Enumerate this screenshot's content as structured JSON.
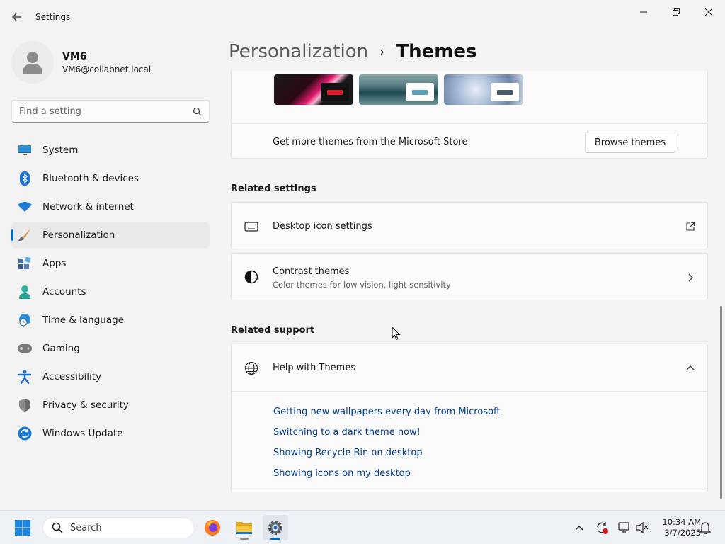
{
  "window": {
    "app_title": "Settings",
    "back_icon": "back-arrow-icon",
    "controls": [
      "minimize-icon",
      "restore-icon",
      "close-icon"
    ]
  },
  "profile": {
    "name": "VM6",
    "email": "VM6@collabnet.local"
  },
  "search": {
    "placeholder": "Find a setting",
    "value": ""
  },
  "sidebar": {
    "items": [
      {
        "label": "System",
        "icon": "monitor-icon"
      },
      {
        "label": "Bluetooth & devices",
        "icon": "bluetooth-icon"
      },
      {
        "label": "Network & internet",
        "icon": "wifi-icon"
      },
      {
        "label": "Personalization",
        "icon": "brush-icon",
        "active": true
      },
      {
        "label": "Apps",
        "icon": "apps-icon"
      },
      {
        "label": "Accounts",
        "icon": "person-icon"
      },
      {
        "label": "Time & language",
        "icon": "globe-clock-icon"
      },
      {
        "label": "Gaming",
        "icon": "gamepad-icon"
      },
      {
        "label": "Accessibility",
        "icon": "accessibility-icon"
      },
      {
        "label": "Privacy & security",
        "icon": "shield-icon"
      },
      {
        "label": "Windows Update",
        "icon": "update-icon"
      }
    ]
  },
  "breadcrumb": {
    "parent": "Personalization",
    "separator": "›",
    "current": "Themes"
  },
  "themes": {
    "more_text": "Get more themes from the Microsoft Store",
    "browse_label": "Browse themes"
  },
  "related_settings": {
    "heading": "Related settings",
    "desktop_icons": {
      "title": "Desktop icon settings",
      "icon": "monitor-outline-icon",
      "action": "external-link-icon"
    },
    "contrast": {
      "title": "Contrast themes",
      "subtitle": "Color themes for low vision, light sensitivity",
      "icon": "contrast-icon",
      "action": "chevron-right-icon"
    }
  },
  "related_support": {
    "heading": "Related support",
    "help": {
      "title": "Help with Themes",
      "icon": "globe-icon",
      "action": "chevron-up-icon"
    },
    "links": [
      "Getting new wallpapers every day from Microsoft",
      "Switching to a dark theme now!",
      "Showing Recycle Bin on desktop",
      "Showing icons on my desktop"
    ]
  },
  "taskbar": {
    "search_label": "Search",
    "time": "10:34 AM",
    "date": "3/7/2025"
  },
  "colors": {
    "accent": "#0067c0",
    "link": "#003e92",
    "background": "#f3f3f3"
  }
}
